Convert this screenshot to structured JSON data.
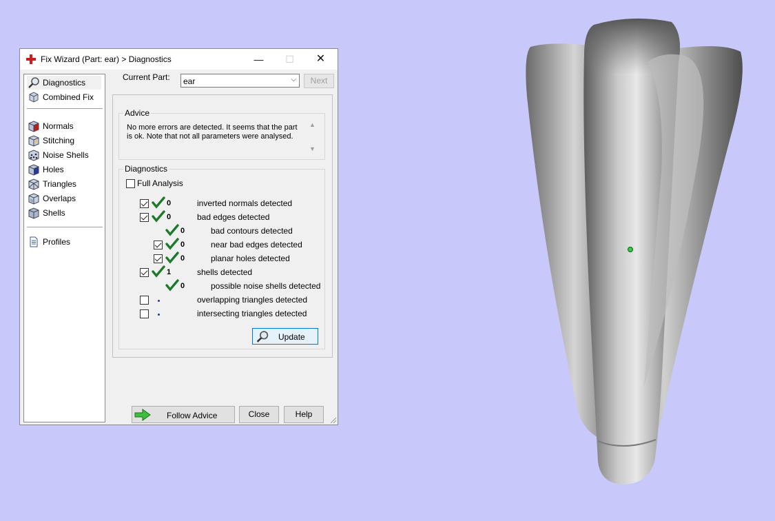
{
  "window": {
    "title": "Fix Wizard (Part: ear) > Diagnostics",
    "min_glyph": "—",
    "max_glyph": "☐",
    "close_glyph": "✕"
  },
  "nav": {
    "group1": [
      {
        "label": "Diagnostics",
        "icon": "magnifier-icon",
        "selected": true
      },
      {
        "label": "Combined Fix",
        "icon": "combined-fix-icon"
      }
    ],
    "group2": [
      {
        "label": "Normals",
        "icon": "normals-cube-icon"
      },
      {
        "label": "Stitching",
        "icon": "stitching-cube-icon"
      },
      {
        "label": "Noise Shells",
        "icon": "noise-shells-icon"
      },
      {
        "label": "Holes",
        "icon": "holes-cube-icon"
      },
      {
        "label": "Triangles",
        "icon": "triangles-cube-icon"
      },
      {
        "label": "Overlaps",
        "icon": "overlaps-cube-icon"
      },
      {
        "label": "Shells",
        "icon": "shells-cube-icon"
      }
    ],
    "group3": [
      {
        "label": "Profiles",
        "icon": "profiles-document-icon"
      }
    ]
  },
  "current_part": {
    "label": "Current Part:",
    "value": "ear",
    "next_label": "Next"
  },
  "advice": {
    "title": "Advice",
    "text": "No more errors are detected. It seems that the part is ok. Note that not all parameters were analysed."
  },
  "diagnostics": {
    "title": "Diagnostics",
    "full_analysis_label": "Full Analysis",
    "rows": [
      {
        "checkbox": true,
        "checked": true,
        "status": "ok",
        "count": "0",
        "text": "inverted normals detected",
        "indent": 0
      },
      {
        "checkbox": true,
        "checked": true,
        "status": "ok",
        "count": "0",
        "text": "bad edges detected",
        "indent": 0
      },
      {
        "checkbox": false,
        "checked": false,
        "status": "ok",
        "count": "0",
        "text": "bad contours detected",
        "indent": 1
      },
      {
        "checkbox": true,
        "checked": true,
        "status": "ok",
        "count": "0",
        "text": "near bad edges detected",
        "indent": 1
      },
      {
        "checkbox": true,
        "checked": true,
        "status": "ok",
        "count": "0",
        "text": "planar holes detected",
        "indent": 1
      },
      {
        "checkbox": true,
        "checked": true,
        "status": "ok",
        "count": "1",
        "text": "shells detected",
        "indent": 0
      },
      {
        "checkbox": false,
        "checked": false,
        "status": "ok",
        "count": "0",
        "text": "possible noise shells detected",
        "indent": 1
      },
      {
        "checkbox": true,
        "checked": false,
        "status": "none",
        "count": "",
        "text": "overlapping triangles detected",
        "indent": 0
      },
      {
        "checkbox": true,
        "checked": false,
        "status": "none",
        "count": "",
        "text": "intersecting triangles detected",
        "indent": 0
      }
    ],
    "update_label": "Update"
  },
  "footer": {
    "follow_advice_label": "Follow Advice",
    "close_label": "Close",
    "help_label": "Help"
  },
  "colors": {
    "background": "#c8c8fa",
    "model": "#9a9a9a",
    "ok_tick": "#1e7a2a",
    "marker": "#2ecc40"
  }
}
